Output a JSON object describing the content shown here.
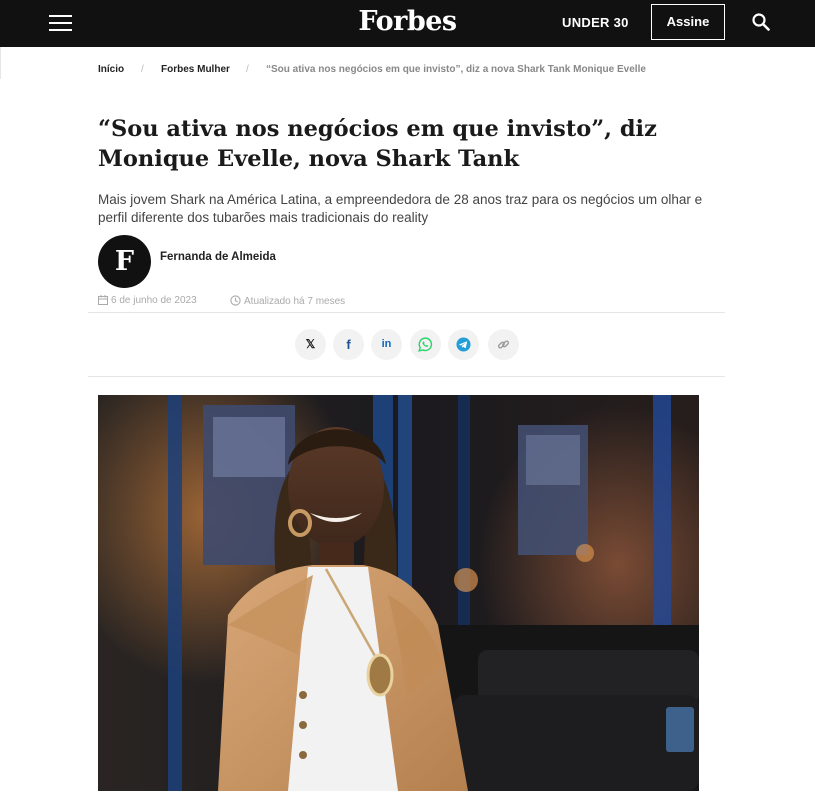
{
  "header": {
    "logo": "Forbes",
    "under30_label": "UNDER 30",
    "subscribe_label": "Assine"
  },
  "breadcrumb": {
    "items": [
      "Início",
      "Forbes Mulher"
    ],
    "separator": "/",
    "current": "“Sou ativa nos negócios em que invisto”, diz a nova Shark Tank Monique Evelle"
  },
  "article": {
    "title": "“Sou ativa nos negócios em que invisto”, diz Monique Evelle, nova Shark Tank",
    "subtitle": "Mais jovem Shark na América Latina, a empreendedora de 28 anos traz para os negócios um olhar e perfil diferente dos tubarões mais tradicionais do reality",
    "author_initial": "F",
    "author_name": "Fernanda de Almeida",
    "published_date": "6 de junho de 2023",
    "updated": "Atualizado há 7 meses"
  },
  "share": {
    "x_label": "𝕏",
    "facebook_label": "f",
    "linkedin_label": "in"
  },
  "colors": {
    "header_bg": "#111111",
    "whatsapp": "#25d366",
    "telegram": "#229ed9",
    "linkedin": "#0a66c2"
  },
  "icons": [
    "menu-icon",
    "search-icon",
    "calendar-icon",
    "clock-icon",
    "x-icon",
    "facebook-icon",
    "linkedin-icon",
    "whatsapp-icon",
    "telegram-icon",
    "link-icon"
  ]
}
